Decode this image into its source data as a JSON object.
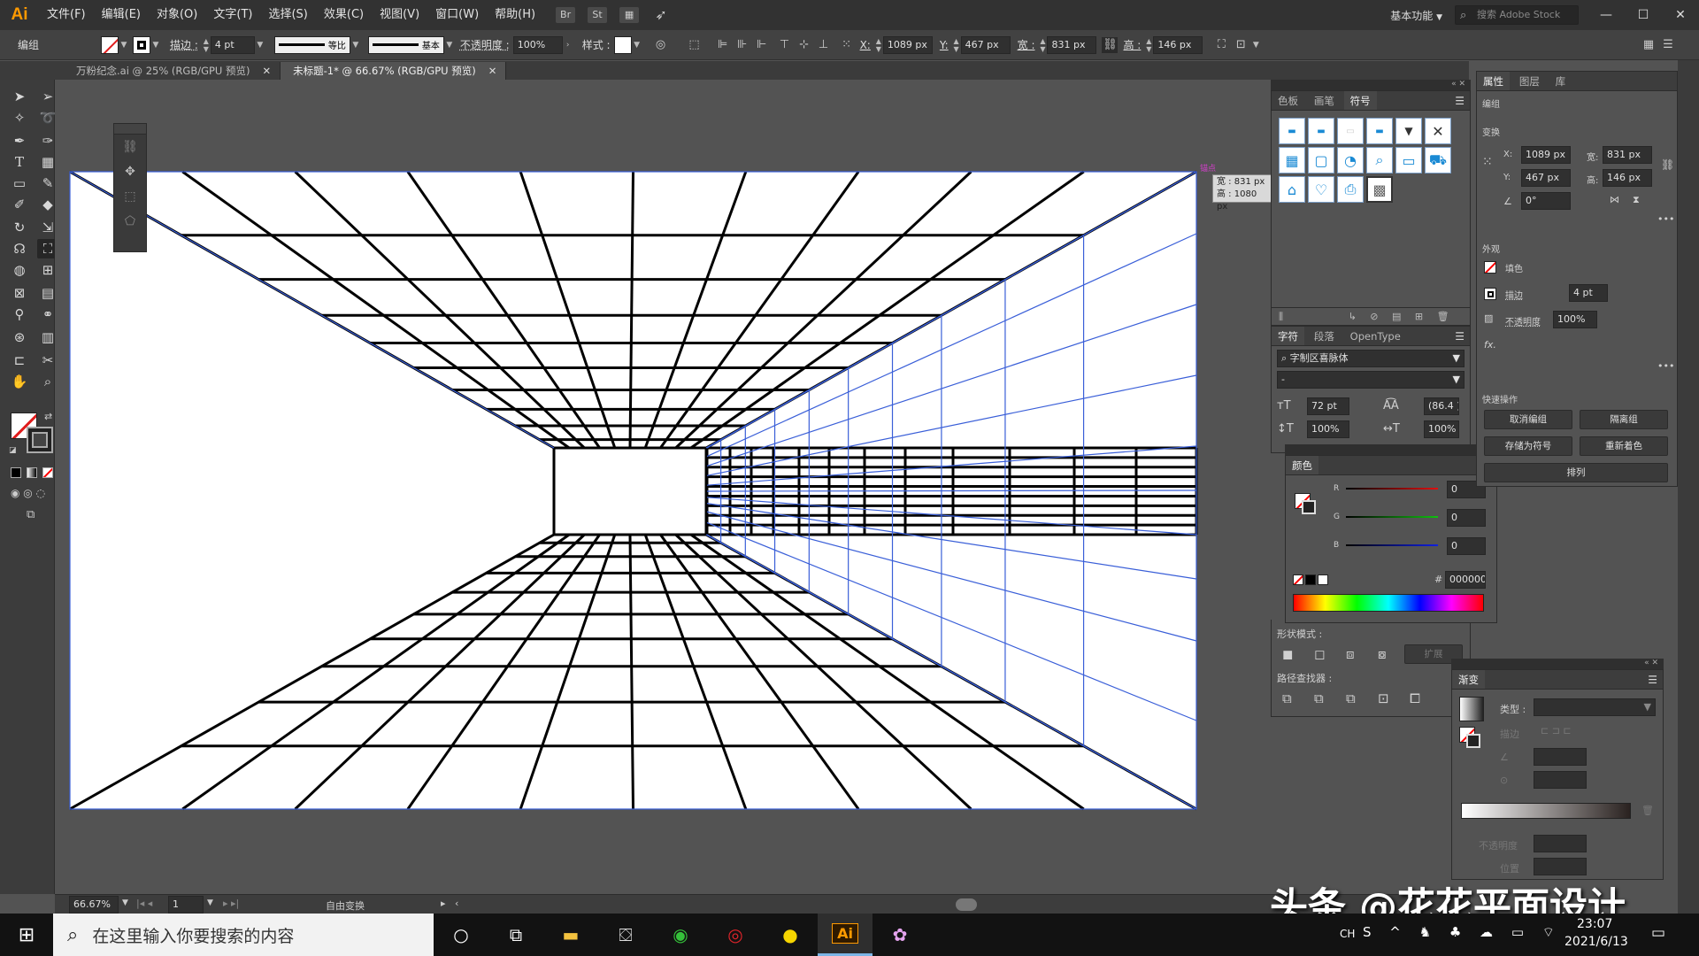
{
  "app": {
    "logo": "Ai"
  },
  "menu": [
    "文件(F)",
    "编辑(E)",
    "对象(O)",
    "文字(T)",
    "选择(S)",
    "效果(C)",
    "视图(V)",
    "窗口(W)",
    "帮助(H)"
  ],
  "menubar_icons": {
    "bridge": "Br",
    "stock": "St",
    "layout": "▦",
    "share": "➶"
  },
  "workspace": "基本功能",
  "search": {
    "placeholder": "搜索 Adobe Stock"
  },
  "window_controls": {
    "min": "—",
    "max": "☐",
    "close": "✕"
  },
  "control_bar": {
    "selection_type": "编组",
    "stroke_label": "描边 :",
    "stroke_weight": "4 pt",
    "profile_label": "等比",
    "brush_label": "基本",
    "opacity_label": "不透明度 :",
    "opacity_value": "100%",
    "style_label": "样式 :",
    "x_label": "X:",
    "x_value": "1089 px",
    "y_label": "Y:",
    "y_value": "467 px",
    "w_label": "宽 :",
    "w_value": "831 px",
    "h_label": "高 :",
    "h_value": "146 px"
  },
  "tabs": [
    {
      "label": "万粉纪念.ai @ 25% (RGB/GPU 预览)",
      "active": false
    },
    {
      "label": "未标题-1* @ 66.67% (RGB/GPU 预览)",
      "active": true
    }
  ],
  "canvas": {
    "tooltip_w": "宽 : 831 px",
    "tooltip_h": "高 : 1080 px",
    "anchor_label": "锚点"
  },
  "symbols_panel": {
    "tabs": [
      "色板",
      "画笔",
      "符号"
    ],
    "active_tab": "符号"
  },
  "properties_panel": {
    "tabs": [
      "属性",
      "图层",
      "库"
    ],
    "active_tab": "属性",
    "group_label": "编组",
    "transform_label": "变换",
    "x_label": "X:",
    "x_value": "1089 px",
    "w_label": "宽:",
    "w_value": "831 px",
    "y_label": "Y:",
    "y_value": "467 px",
    "h_label": "高:",
    "h_value": "146 px",
    "angle_value": "0°",
    "appearance_label": "外观",
    "fill_label": "填色",
    "stroke_label": "描边",
    "stroke_value": "4 pt",
    "opacity_label": "不透明度",
    "opacity_value": "100%",
    "fx_label": "fx.",
    "quick_actions_label": "快速操作",
    "btn_ungroup": "取消编组",
    "btn_isolate": "隔离组",
    "btn_save_symbol": "存储为符号",
    "btn_recolor": "重新着色",
    "btn_arrange": "排列"
  },
  "character_panel": {
    "tabs": [
      "字符",
      "段落",
      "OpenType"
    ],
    "active_tab": "字符",
    "font_family": "字制区喜脉体",
    "font_style": "-",
    "font_size": "72 pt",
    "leading": "(86.4 )",
    "vscale": "100%",
    "hscale": "100%"
  },
  "color_panel": {
    "title": "颜色",
    "r_label": "R",
    "r_value": "0",
    "g_label": "G",
    "g_value": "0",
    "b_label": "B",
    "b_value": "0",
    "hex_label": "#",
    "hex_value": "000000"
  },
  "pathfinder": {
    "shape_modes_label": "形状模式 :",
    "expand_label": "扩展",
    "pathfinder_label": "路径查找器 :"
  },
  "gradient_panel": {
    "title": "渐变",
    "type_label": "类型 :",
    "stroke_label": "描边",
    "opacity_label": "不透明度",
    "location_label": "位置"
  },
  "status_bar": {
    "zoom": "66.67%",
    "artboard_number": "1",
    "tool_name": "自由变换"
  },
  "taskbar": {
    "search_placeholder": "在这里输入你要搜索的内容",
    "time": "23:07",
    "date": "2021/6/13",
    "ime": "CH",
    "ai_app_label": "Ai"
  },
  "watermark": "头条 @花花平面设计",
  "colors": {
    "ui_dark": "#323232",
    "ui_panel": "#535353",
    "guide_blue": "#3a5fd8",
    "ai_orange": "#ff9a00"
  }
}
